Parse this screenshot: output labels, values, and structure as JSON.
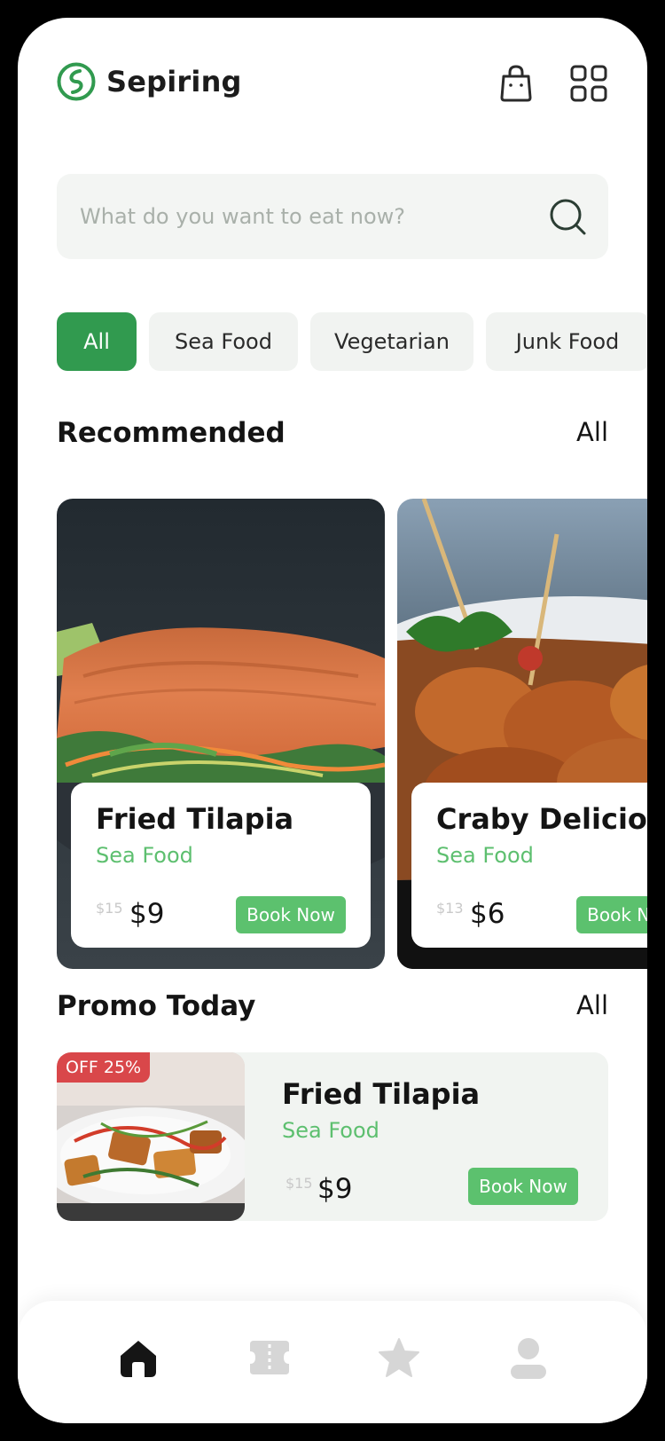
{
  "header": {
    "app_name": "Sepiring",
    "icons": {
      "logo": "sepiring-logo-icon",
      "bag": "shopping-bag-icon",
      "menu": "grid-menu-icon"
    }
  },
  "search": {
    "placeholder": "What do you want to eat now?",
    "icon": "search-icon"
  },
  "categories": [
    {
      "label": "All",
      "active": true
    },
    {
      "label": "Sea Food",
      "active": false
    },
    {
      "label": "Vegetarian",
      "active": false
    },
    {
      "label": "Junk Food",
      "active": false
    }
  ],
  "recommended": {
    "title": "Recommended",
    "link": "All",
    "items": [
      {
        "name": "Fried Tilapia",
        "category": "Sea Food",
        "old_price": "$15",
        "price": "$9",
        "button": "Book Now"
      },
      {
        "name": "Craby Delicious",
        "category": "Sea Food",
        "old_price": "$13",
        "price": "$6",
        "button": "Book Now"
      }
    ]
  },
  "promo": {
    "title": "Promo Today",
    "link": "All",
    "item": {
      "badge": "OFF 25%",
      "name": "Fried Tilapia",
      "category": "Sea Food",
      "old_price": "$15",
      "price": "$9",
      "button": "Book Now"
    }
  },
  "nav": {
    "items": [
      {
        "icon": "home-icon",
        "active": true
      },
      {
        "icon": "ticket-icon",
        "active": false
      },
      {
        "icon": "star-icon",
        "active": false
      },
      {
        "icon": "profile-icon",
        "active": false
      }
    ]
  },
  "colors": {
    "brand_green": "#319a4f",
    "button_green": "#5cc16e",
    "category_text": "#5dbf6f",
    "badge_red": "#d9474a"
  }
}
